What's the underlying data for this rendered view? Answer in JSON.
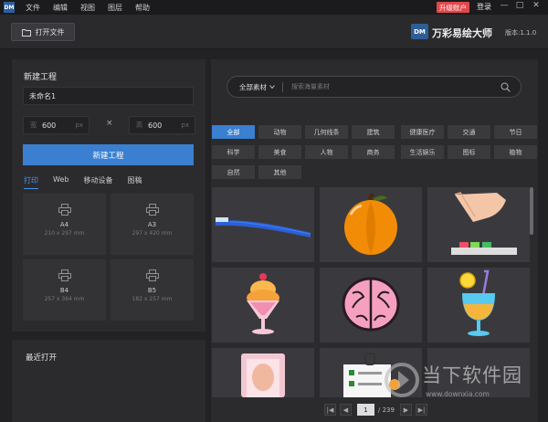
{
  "app": {
    "logo": "DM",
    "menu": [
      "文件",
      "编辑",
      "视图",
      "图层",
      "帮助"
    ],
    "upgrade_label": "升级账户",
    "login_label": "登录"
  },
  "window_controls": {
    "minimize": "—",
    "maximize": "□",
    "close": "✕"
  },
  "toolbar": {
    "open_file_label": "打开文件",
    "brand_logo": "DM",
    "brand_name": "万彩易绘大师",
    "version": "版本:1.1.0"
  },
  "new_project": {
    "title": "新建工程",
    "name_value": "未命名1",
    "width_value": "600",
    "height_value": "600",
    "unit": "px",
    "width_icon": "宽",
    "height_icon": "高",
    "times": "×",
    "create_label": "新建工程",
    "tabs": [
      "打印",
      "Web",
      "移动设备",
      "图稿"
    ],
    "active_tab": 0,
    "presets": [
      {
        "name": "A4",
        "size": "210 x 297 mm"
      },
      {
        "name": "A3",
        "size": "297 x 420 mm"
      },
      {
        "name": "B4",
        "size": "257 x 364 mm"
      },
      {
        "name": "B5",
        "size": "182 x 257 mm"
      }
    ]
  },
  "recent": {
    "title": "最近打开"
  },
  "assets": {
    "filter_label": "全部素材",
    "search_placeholder": "搜索海量素材",
    "categories": [
      "全部",
      "动物",
      "几何线条",
      "建筑",
      "健康医疗",
      "交通",
      "节日",
      "科学",
      "美食",
      "人物",
      "商务",
      "生活娱乐",
      "图标",
      "植物",
      "自然",
      "其他"
    ],
    "active_category": 0,
    "items": [
      "toothbrush",
      "pumpkin",
      "hand-pressing-buttons",
      "ice-cream-sundae",
      "brain",
      "cocktail",
      "face-mask-pack",
      "clipboard-checklist",
      "empty"
    ]
  },
  "pagination": {
    "first": "|◀",
    "prev": "◀",
    "current": "1",
    "total": "/ 239",
    "next": "▶",
    "last": "▶|"
  },
  "watermark": {
    "text": "当下软件园",
    "url": "www.downxia.com"
  },
  "colors": {
    "accent": "#3a7fd0",
    "upgrade": "#e0484b",
    "background": "#222225",
    "panel": "#2b2b2e"
  }
}
